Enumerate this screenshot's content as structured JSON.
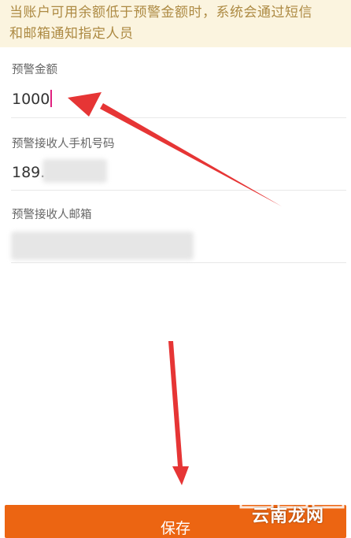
{
  "notice": {
    "line1": "当账户可用余额低于预警金额时，系统会通过短信",
    "line2": "和邮箱通知指定人员"
  },
  "form": {
    "amount": {
      "label": "预警金额",
      "value": "1000"
    },
    "phone": {
      "label": "预警接收人手机号码",
      "value": "189."
    },
    "email": {
      "label": "预警接收人邮箱",
      "value": ""
    }
  },
  "save_button": {
    "label": "保存"
  },
  "watermark": {
    "text": "云南龙网"
  },
  "colors": {
    "notice_bg": "#fbf4df",
    "notice_text": "#ad8a43",
    "accent": "#ec6512",
    "annotation_arrow": "#e63535"
  }
}
